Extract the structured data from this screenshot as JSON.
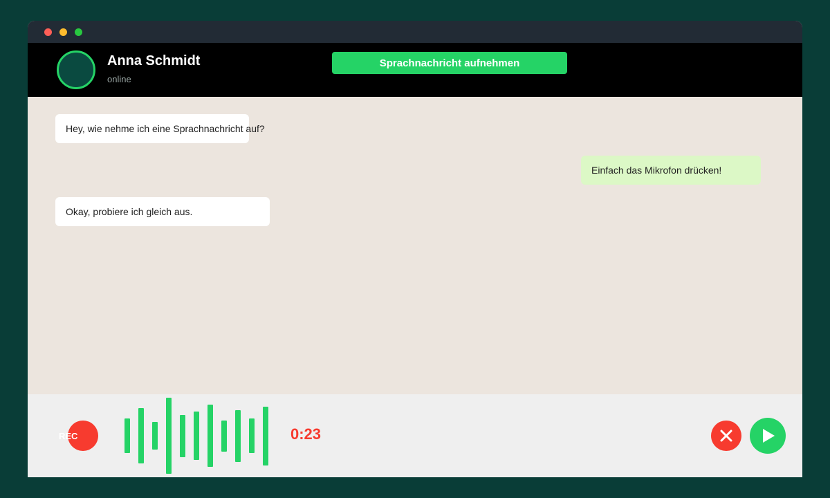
{
  "window": {
    "traffic_lights": [
      "close",
      "minimize",
      "maximize"
    ]
  },
  "header": {
    "contact_name": "Anna Schmidt",
    "contact_status": "online",
    "record_button_label": "Sprachnachricht aufnehmen"
  },
  "chat": {
    "messages": [
      {
        "direction": "incoming",
        "text": "Hey, wie nehme ich eine Sprachnachricht auf?"
      },
      {
        "direction": "outgoing",
        "text": "Einfach das Mikrofon drücken!"
      },
      {
        "direction": "incoming",
        "text": "Okay, probiere ich gleich aus."
      }
    ]
  },
  "recording": {
    "indicator_label": "REC",
    "timer": "0:23",
    "waveform_levels": [
      0.45,
      0.73,
      0.36,
      1.0,
      0.55,
      0.64,
      0.82,
      0.41,
      0.68,
      0.45,
      0.77
    ],
    "cancel_icon": "close-icon",
    "send_icon": "play-send-icon"
  },
  "colors": {
    "accent_green": "#25d366",
    "record_red": "#f73b2f",
    "outgoing_bubble": "#dcf8c6",
    "chat_background": "#ece5de"
  }
}
